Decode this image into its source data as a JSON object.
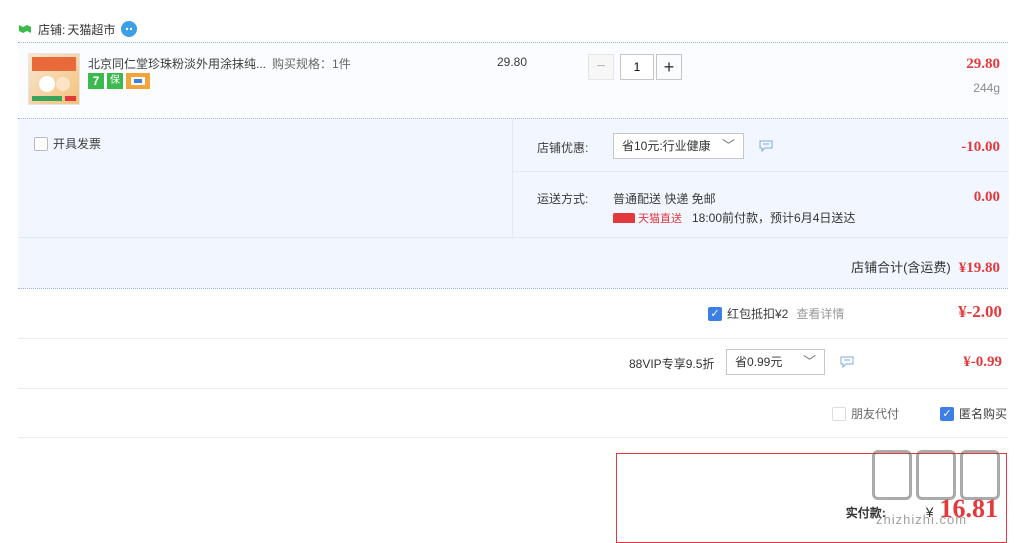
{
  "shop": {
    "label": "店铺:",
    "name": "天猫超市",
    "badge": ""
  },
  "item": {
    "title": "北京同仁堂珍珠粉淡外用涂抹纯...",
    "spec": "购买规格：1件",
    "price": "29.80",
    "quantity": "1",
    "subtotal": "29.80",
    "weight": "244g",
    "minus": "−",
    "plus": "+",
    "badges": [
      "7",
      "保",
      "卡"
    ]
  },
  "invoice": {
    "label": "开具发票"
  },
  "coupon": {
    "label": "店铺优惠:",
    "selected": "省10元:行业健康",
    "amount": "-10.00"
  },
  "shipping": {
    "label": "运送方式:",
    "method": "普通配送 快递 免邮",
    "brand": "天猫直送",
    "eta": "18:00前付款，预计6月4日送达",
    "amount": "0.00"
  },
  "store_total": {
    "label": "店铺合计(含运费)",
    "amount": "¥19.80"
  },
  "redpacket": {
    "label": "红包抵扣¥2",
    "link": "查看详情",
    "amount": "¥-2.00"
  },
  "vip": {
    "label": "88VIP专享9.5折",
    "selected": "省0.99元",
    "amount": "¥-0.99"
  },
  "options": {
    "friend_pay": "朋友代付",
    "anonymous": "匿名购买"
  },
  "pay": {
    "label": "实付款:",
    "currency": "¥",
    "amount": "16.81",
    "partial": ""
  },
  "watermark": {
    "top": "值",
    "bottom": "zhizhizhi.com"
  },
  "colors": {
    "price_red": "#e4393c",
    "panel_bg": "#f2f7ff",
    "accent_blue": "#3d7fe4"
  }
}
